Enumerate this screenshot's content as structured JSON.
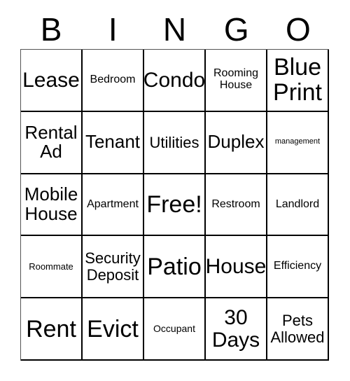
{
  "card": {
    "title_letters": [
      "B",
      "I",
      "N",
      "G",
      "O"
    ],
    "columns": 5,
    "rows": 5,
    "free_space": "Free!",
    "text_color": "#000000",
    "background_color": "#ffffff",
    "border_color": "#000000",
    "cells": [
      [
        {
          "label": "Lease",
          "size": "fs-2xl"
        },
        {
          "label": "Bedroom",
          "size": "fs-md"
        },
        {
          "label": "Condo",
          "size": "fs-2xl"
        },
        {
          "label": "Rooming\nHouse",
          "size": "fs-md"
        },
        {
          "label": "Blue\nPrint",
          "size": "fs-3xl"
        }
      ],
      [
        {
          "label": "Rental\nAd",
          "size": "fs-xl"
        },
        {
          "label": "Tenant",
          "size": "fs-xl"
        },
        {
          "label": "Utilities",
          "size": "fs-lg"
        },
        {
          "label": "Duplex",
          "size": "fs-xl"
        },
        {
          "label": "management",
          "size": "fs-xs"
        }
      ],
      [
        {
          "label": "Mobile\nHouse",
          "size": "fs-xl"
        },
        {
          "label": "Apartment",
          "size": "fs-md"
        },
        {
          "label": "Free!",
          "size": "fs-3xl"
        },
        {
          "label": "Restroom",
          "size": "fs-md"
        },
        {
          "label": "Landlord",
          "size": "fs-md"
        }
      ],
      [
        {
          "label": "Roommate",
          "size": "fs-sm"
        },
        {
          "label": "Security\nDeposit",
          "size": "fs-lg"
        },
        {
          "label": "Patio",
          "size": "fs-3xl"
        },
        {
          "label": "House",
          "size": "fs-2xl"
        },
        {
          "label": "Efficiency",
          "size": "fs-md"
        }
      ],
      [
        {
          "label": "Rent",
          "size": "fs-3xl"
        },
        {
          "label": "Evict",
          "size": "fs-3xl"
        },
        {
          "label": "Occupant",
          "size": "fs-smp"
        },
        {
          "label": "30\nDays",
          "size": "fs-2xl"
        },
        {
          "label": "Pets\nAllowed",
          "size": "fs-lg"
        }
      ]
    ]
  }
}
